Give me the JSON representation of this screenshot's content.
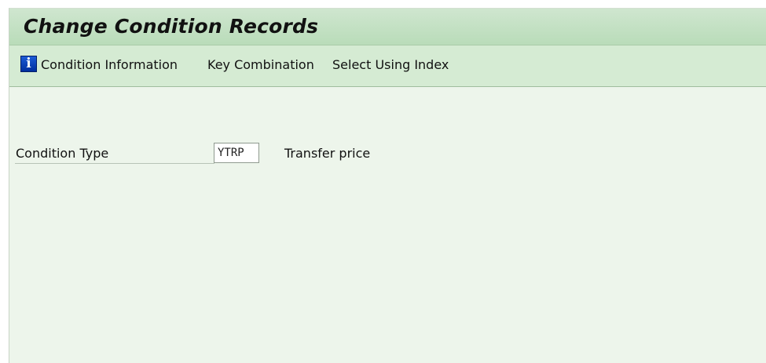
{
  "header": {
    "title": "Change Condition Records"
  },
  "toolbar": {
    "items": [
      {
        "label": "Condition Information",
        "icon": "info-icon"
      },
      {
        "label": "Key Combination"
      },
      {
        "label": "Select Using Index"
      }
    ],
    "info_glyph": "i"
  },
  "form": {
    "condition_type_label": "Condition Type",
    "condition_type_value": "YTRP",
    "condition_type_description": "Transfer price"
  },
  "colors": {
    "title_bar": "#b9dcb9",
    "toolbar": "#d5ebd3",
    "background": "#edf5eb",
    "info_icon": "#0a44b8"
  }
}
